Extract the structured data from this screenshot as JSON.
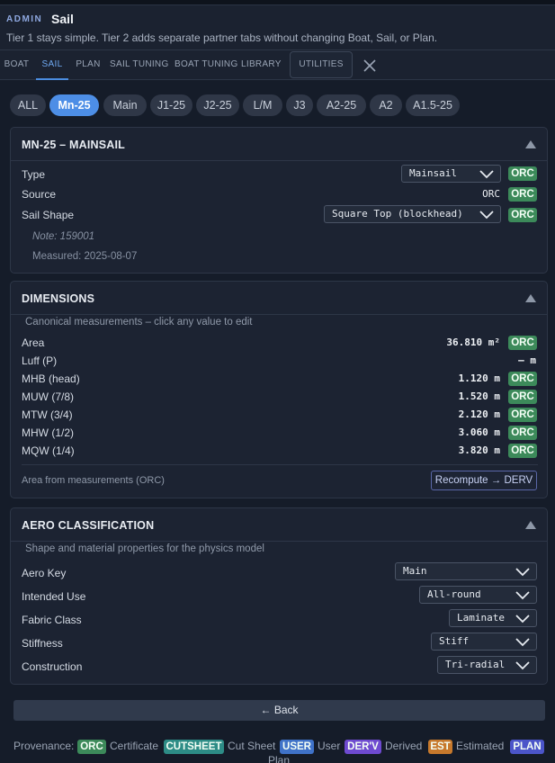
{
  "header": {
    "admin_label": "ADMIN",
    "title": "Sail",
    "subtitle": "Tier 1 stays simple. Tier 2 adds separate partner tabs without changing Boat, Sail, or Plan."
  },
  "tabs": [
    {
      "label": "BOAT",
      "active": false
    },
    {
      "label": "SAIL",
      "active": true
    },
    {
      "label": "PLAN",
      "active": false
    },
    {
      "label": "SAIL TUNING",
      "active": false
    },
    {
      "label": "BOAT TUNING",
      "active": false
    },
    {
      "label": "LIBRARY",
      "active": false
    },
    {
      "label": "UTILITIES",
      "active": false
    }
  ],
  "sail_chips": [
    {
      "label": "ALL",
      "active": false
    },
    {
      "label": "Mn-25",
      "active": true
    },
    {
      "label": "Main",
      "active": false
    },
    {
      "label": "J1-25",
      "active": false
    },
    {
      "label": "J2-25",
      "active": false
    },
    {
      "label": "L/M",
      "active": false
    },
    {
      "label": "J3",
      "active": false
    },
    {
      "label": "A2-25",
      "active": false
    },
    {
      "label": "A2",
      "active": false
    },
    {
      "label": "A1.5-25",
      "active": false
    }
  ],
  "sail_panel": {
    "title": "MN-25 – MAINSAIL",
    "type_label": "Type",
    "type_value": "Mainsail",
    "type_source": "ORC",
    "source_label": "Source",
    "source_value": "ORC",
    "source_badge": "ORC",
    "shape_label": "Sail Shape",
    "shape_value": "Square Top (blockhead)",
    "shape_source": "ORC",
    "note": "Note: 159001",
    "measured": "Measured: 2025-08-07"
  },
  "dimensions": {
    "title": "DIMENSIONS",
    "hint": "Canonical measurements – click any value to edit",
    "rows": [
      {
        "label": "Area",
        "value": "36.810 m²",
        "badge": "ORC"
      },
      {
        "label": "Luff (P)",
        "value": "— m",
        "badge": ""
      },
      {
        "label": "MHB (head)",
        "value": "1.120 m",
        "badge": "ORC"
      },
      {
        "label": "MUW (7/8)",
        "value": "1.520 m",
        "badge": "ORC"
      },
      {
        "label": "MTW (3/4)",
        "value": "2.120 m",
        "badge": "ORC"
      },
      {
        "label": "MHW (1/2)",
        "value": "3.060 m",
        "badge": "ORC"
      },
      {
        "label": "MQW (1/4)",
        "value": "3.820 m",
        "badge": "ORC"
      }
    ],
    "footer_note": "Area from measurements (ORC)",
    "recompute_label": "Recompute → DERV"
  },
  "aero": {
    "title": "AERO CLASSIFICATION",
    "hint": "Shape and material properties for the physics model",
    "rows": [
      {
        "label": "Aero Key",
        "value": "Main"
      },
      {
        "label": "Intended Use",
        "value": "All-round"
      },
      {
        "label": "Fabric Class",
        "value": "Laminate"
      },
      {
        "label": "Stiffness",
        "value": "Stiff"
      },
      {
        "label": "Construction",
        "value": "Tri-radial"
      }
    ]
  },
  "back_label": "← Back",
  "provenance": {
    "label": "Provenance:",
    "items": [
      {
        "badge": "ORC",
        "text": "Certificate"
      },
      {
        "badge": "CUTSHEET",
        "text": "Cut Sheet"
      },
      {
        "badge": "USER",
        "text": "User"
      },
      {
        "badge": "DER'V",
        "text": "Derived"
      },
      {
        "badge": "EST",
        "text": "Estimated"
      },
      {
        "badge": "PLAN",
        "text": "Plan"
      }
    ]
  },
  "colors": {
    "accent": "#4d8ee6",
    "orc": "#3c8a5a",
    "cutsheet": "#2d8c86",
    "user": "#3f72c8",
    "derived": "#6e4ad0",
    "estimated": "#c7792c",
    "plan": "#4b55c9"
  }
}
